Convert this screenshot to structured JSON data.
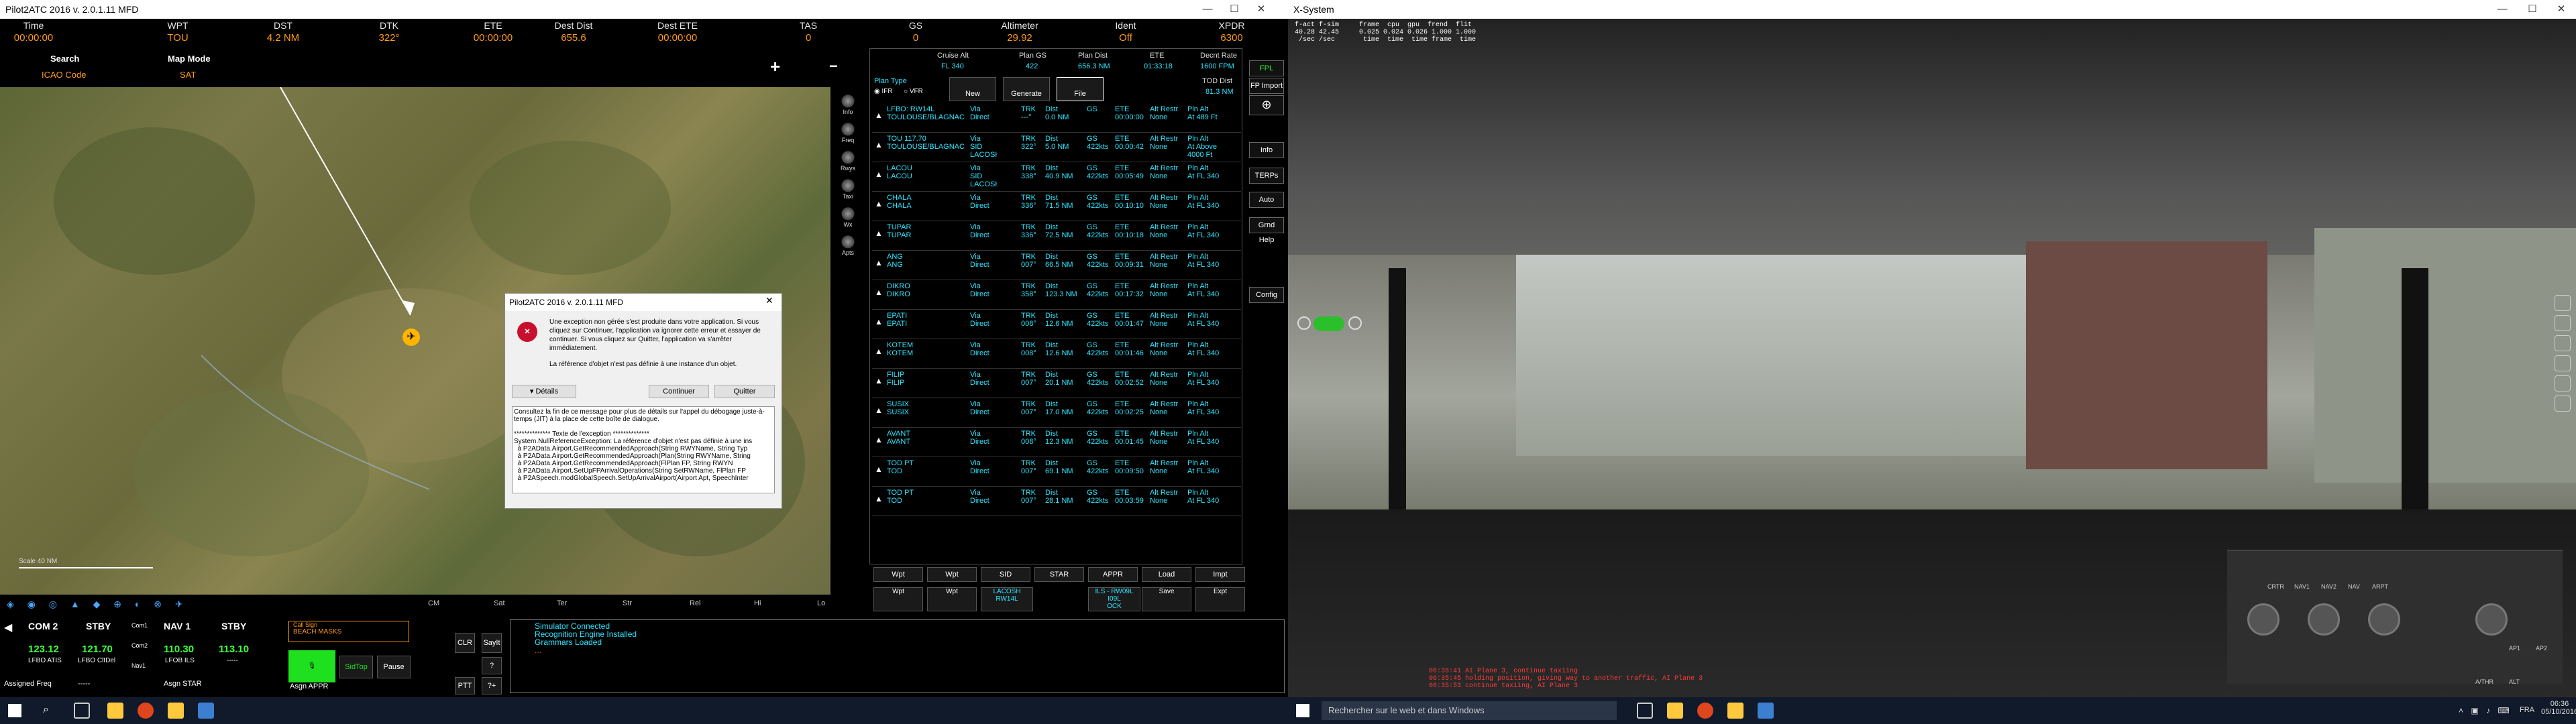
{
  "left_window": {
    "title": "Pilot2ATC 2016 v. 2.0.1.11 MFD",
    "controls": [
      "—",
      "☐",
      "✕"
    ]
  },
  "topbar": [
    {
      "label": "Time",
      "value": "00:00:00"
    },
    {
      "label": "WPT",
      "value": "TOU"
    },
    {
      "label": "DST",
      "value": "4.2 NM"
    },
    {
      "label": "DTK",
      "value": "322°"
    },
    {
      "label": "ETE",
      "value": "00:00:00"
    },
    {
      "label": "Dest Dist",
      "value": "655.6"
    },
    {
      "label": "Dest ETE",
      "value": "00:00:00"
    },
    {
      "label": "TAS",
      "value": "0"
    },
    {
      "label": "GS",
      "value": "0"
    },
    {
      "label": "Altimeter",
      "value": "29.92"
    },
    {
      "label": "Ident",
      "value": "Off"
    },
    {
      "label": "XPDR",
      "value": "6300"
    }
  ],
  "map_header": {
    "search_label": "Search",
    "search_value": "ICAO Code",
    "mapmode_label": "Map Mode",
    "mapmode_value": "SAT",
    "scale_text": "Scale 40 NM",
    "plus": "+",
    "minus": "−"
  },
  "map_footer_labels": [
    "CM",
    "Sat",
    "Ter",
    "Str",
    "Rel",
    "Hi",
    "Lo"
  ],
  "map_side_buttons": [
    "Info",
    "Freq",
    "Rwys",
    "Taxi",
    "Wx",
    "Apts"
  ],
  "plan": {
    "cruise_alt_label": "Cruise Alt",
    "cruise_alt": "FL 340",
    "plan_gs_label": "Plan GS",
    "plan_gs": "422",
    "plan_dist_label": "Plan Dist",
    "plan_dist": "656.3 NM",
    "ete_label": "ETE",
    "ete": "01:33:18",
    "descent_label": "Decnt Rate",
    "descent": "1600 FPM",
    "tod_label": "TOD Dist",
    "tod": "81.3 NM",
    "plan_type_label": "Plan Type",
    "ifr": "IFR",
    "vfr": "VFR",
    "buttons": [
      "New",
      "Generate",
      "File"
    ]
  },
  "plan_rows": [
    {
      "wp": "LFBO: RW14L\nTOULOUSE/BLAGNAC",
      "via": "Via\nDirect",
      "trk": "TRK\n---°",
      "dst": "Dist\n0.0 NM",
      "gs": "GS\n",
      "ete": "ETE\n00:00:00",
      "alt": "Alt Restr\nNone",
      "pln": "Pln Alt\nAt 489 Ft"
    },
    {
      "wp": "TOU 117.70\nTOULOUSE/BLAGNAC",
      "via": "Via\nSID\nLACOSH",
      "trk": "TRK\n322°",
      "dst": "Dist\n5.0 NM",
      "gs": "GS\n422kts",
      "ete": "ETE\n00:00:42",
      "alt": "Alt Restr\nNone",
      "pln": "Pln Alt\nAt Above\n4000 Ft"
    },
    {
      "wp": "LACOU\nLACOU",
      "via": "Via\nSID\nLACOSH",
      "trk": "TRK\n338°",
      "dst": "Dist\n40.9 NM",
      "gs": "GS\n422kts",
      "ete": "ETE\n00:05:49",
      "alt": "Alt Restr\nNone",
      "pln": "Pln Alt\nAt FL 340"
    },
    {
      "wp": "CHALA\nCHALA",
      "via": "Via\nDirect",
      "trk": "TRK\n336°",
      "dst": "Dist\n71.5 NM",
      "gs": "GS\n422kts",
      "ete": "ETE\n00:10:10",
      "alt": "Alt Restr\nNone",
      "pln": "Pln Alt\nAt FL 340"
    },
    {
      "wp": "TUPAR\nTUPAR",
      "via": "Via\nDirect",
      "trk": "TRK\n336°",
      "dst": "Dist\n72.5 NM",
      "gs": "GS\n422kts",
      "ete": "ETE\n00:10:18",
      "alt": "Alt Restr\nNone",
      "pln": "Pln Alt\nAt FL 340"
    },
    {
      "wp": "ANG\nANG",
      "via": "Via\nDirect",
      "trk": "TRK\n007°",
      "dst": "Dist\n66.5 NM",
      "gs": "GS\n422kts",
      "ete": "ETE\n00:09:31",
      "alt": "Alt Restr\nNone",
      "pln": "Pln Alt\nAt FL 340"
    },
    {
      "wp": "DIKRO\nDIKRO",
      "via": "Via\nDirect",
      "trk": "TRK\n358°",
      "dst": "Dist\n123.3 NM",
      "gs": "GS\n422kts",
      "ete": "ETE\n00:17:32",
      "alt": "Alt Restr\nNone",
      "pln": "Pln Alt\nAt FL 340"
    },
    {
      "wp": "EPATI\nEPATI",
      "via": "Via\nDirect",
      "trk": "TRK\n008°",
      "dst": "Dist\n12.6 NM",
      "gs": "GS\n422kts",
      "ete": "ETE\n00:01:47",
      "alt": "Alt Restr\nNone",
      "pln": "Pln Alt\nAt FL 340"
    },
    {
      "wp": "KOTEM\nKOTEM",
      "via": "Via\nDirect",
      "trk": "TRK\n008°",
      "dst": "Dist\n12.6 NM",
      "gs": "GS\n422kts",
      "ete": "ETE\n00:01:46",
      "alt": "Alt Restr\nNone",
      "pln": "Pln Alt\nAt FL 340"
    },
    {
      "wp": "FILIP\nFILIP",
      "via": "Via\nDirect",
      "trk": "TRK\n007°",
      "dst": "Dist\n20.1 NM",
      "gs": "GS\n422kts",
      "ete": "ETE\n00:02:52",
      "alt": "Alt Restr\nNone",
      "pln": "Pln Alt\nAt FL 340"
    },
    {
      "wp": "SUSIX\nSUSIX",
      "via": "Via\nDirect",
      "trk": "TRK\n007°",
      "dst": "Dist\n17.0 NM",
      "gs": "GS\n422kts",
      "ete": "ETE\n00:02:25",
      "alt": "Alt Restr\nNone",
      "pln": "Pln Alt\nAt FL 340"
    },
    {
      "wp": "AVANT\nAVANT",
      "via": "Via\nDirect",
      "trk": "TRK\n008°",
      "dst": "Dist\n12.3 NM",
      "gs": "GS\n422kts",
      "ete": "ETE\n00:01:45",
      "alt": "Alt Restr\nNone",
      "pln": "Pln Alt\nAt FL 340"
    },
    {
      "wp": "TOD PT\nTOD",
      "via": "Via\nDirect",
      "trk": "TRK\n007°",
      "dst": "Dist\n69.1 NM",
      "gs": "GS\n422kts",
      "ete": "ETE\n00:09:50",
      "alt": "Alt Restr\nNone",
      "pln": "Pln Alt\nAt FL 340"
    },
    {
      "wp": "TOD PT\nTOD",
      "via": "Via\nDirect",
      "trk": "TRK\n007°",
      "dst": "Dist\n28.1 NM",
      "gs": "GS\n422kts",
      "ete": "ETE\n00:03:59",
      "alt": "Alt Restr\nNone",
      "pln": "Pln Alt\nAt FL 340"
    }
  ],
  "plan_bottom_buttons": [
    "Wpt",
    "Wpt",
    "SID",
    "STAR",
    "APPR",
    "Load",
    "Impt"
  ],
  "plan_bottom_row2": {
    "b1": "Wpt",
    "b2": "Wpt",
    "sid": "LACOSH\nRW14L",
    "appr": "ILS - RW09L\nI09L\nOCK",
    "save": "Save",
    "expt": "Expt"
  },
  "side_buttons": [
    "FPL",
    "FP Import",
    "Info",
    "TERPs",
    "Auto",
    "Grnd Help",
    "Config"
  ],
  "dialog": {
    "title": "Pilot2ATC 2016 v. 2.0.1.11 MFD",
    "message1": "Une exception non gérée s'est produite dans votre application. Si vous cliquez sur Continuer, l'application va ignorer cette erreur et essayer de continuer. Si vous cliquez sur Quitter, l'application va s'arrêter immédiatement.",
    "message2": "La référence d'objet n'est pas définie à une instance d'un objet.",
    "details": "▾ Détails",
    "continue": "Continuer",
    "quit": "Quitter",
    "trace": "Consultez la fin de ce message pour plus de détails sur l'appel du débogage juste-à-temps (JIT) à la place de cette boîte de dialogue.\n\n************** Texte de l'exception **************\nSystem.NullReferenceException: La référence d'objet n'est pas définie à une ins\n  à P2AData.Airport.GetRecommendedApproach(String RWYName, String Typ\n  à P2AData.Airport.GetRecommendedApproach(Plan(String RWYName, String\n  à P2AData.Airport.GetRecommendedApproach(FlPlan FP, String RWYN\n  à P2AData.Airport.SetUpFPArrivalOperations(String SetRWName, FlPlan FP\n  à P2ASpeech.modGlobalSpeech.SetUpArrivalAirport(Airport Apt, SpeechInter"
  },
  "radio": {
    "com2_label": "COM 2",
    "com2_active": "123.12",
    "com2_active_sub": "LFBO ATIS",
    "com2_stby_label": "STBY",
    "com2_stby": "121.70",
    "com2_stby_sub": "LFBO CltDel",
    "nav1_label": "NAV 1",
    "nav1_active": "110.30",
    "nav1_sub": "LFOB ILS",
    "nav1_stby_label": "STBY",
    "nav1_stby": "113.10",
    "nav1_stby_sub": "-----",
    "com1_label": "Com1",
    "com2_small": "Com2",
    "nav_small": "Nav1",
    "assigned": "Assigned Freq",
    "assigned_val": "-----",
    "assign_star": "Asgn STAR",
    "assign_appr": "Asgn APPR",
    "callsign_label": "Call Sign",
    "callsign": "BEACH MASKS",
    "sidtop": "SidTop",
    "pause": "Pause",
    "clr": "CLR",
    "sayit": "SayIt",
    "q": "?",
    "ptt": "PTT",
    "tplus": "?+",
    "status_lines": [
      "Simulator Connected",
      "Recognition Engine Installed",
      "Grammars Loaded",
      "..."
    ]
  },
  "xsystem": {
    "title": "X-System",
    "fps_text": "f-act f-sim     frame  cpu  gpu  frend  flit\n40.28 42.45     0.025 0.024 0.026 1.000 1.000\n /sec /sec       time  time  time frame  time",
    "log_lines": [
      "06:35:41 AI Plane 3, continue taxiing",
      "06:35:45 holding position, giving way to another traffic, AI Plane 3",
      "06:35:53 continue taxiing, AI Plane 3"
    ],
    "labels": [
      "CRTR",
      "NAV1",
      "NAV2",
      "NAV",
      "ARPT",
      "AP1",
      "AP2",
      "ALT",
      "A/THR"
    ]
  },
  "taskbar": {
    "search": "Rechercher sur le web et dans Windows",
    "time": "06:36",
    "date": "05/10/2016",
    "lang": "FRA"
  }
}
